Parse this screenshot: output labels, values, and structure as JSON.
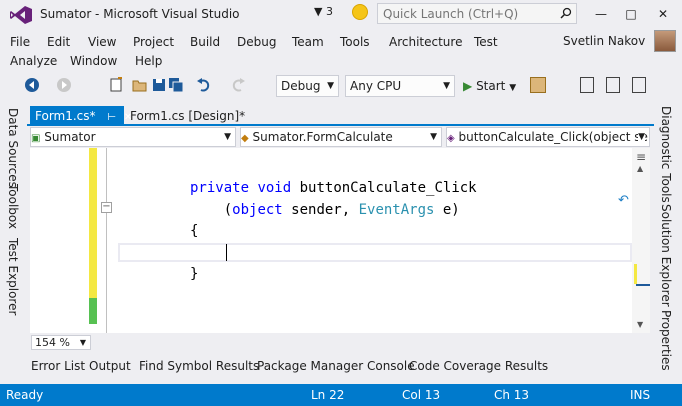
{
  "window": {
    "title": "Sumator - Microsoft Visual Studio",
    "notification_count": "3",
    "quick_launch_placeholder": "Quick Launch (Ctrl+Q)"
  },
  "menu": {
    "row1": [
      "File",
      "Edit",
      "View",
      "Project",
      "Build",
      "Debug",
      "Team",
      "Tools",
      "Architecture",
      "Test"
    ],
    "row2": [
      "Analyze",
      "Window",
      "Help"
    ],
    "user_name": "Svetlin Nakov"
  },
  "toolbar": {
    "configuration": "Debug",
    "platform": "Any CPU",
    "start_label": "Start"
  },
  "left_tabs": [
    "Data Sources",
    "Toolbox",
    "Test Explorer"
  ],
  "right_tabs": [
    "Diagnostic Tools",
    "Solution Explorer",
    "Properties"
  ],
  "doc_tabs": {
    "active": "Form1.cs*",
    "inactive": "Form1.cs [Design]*"
  },
  "navbar": {
    "project": "Sumator",
    "class": "Sumator.FormCalculate",
    "member": "buttonCalculate_Click(object se"
  },
  "code": {
    "line1_kw1": "private",
    "line1_kw2": "void",
    "line1_name": " buttonCalculate_Click",
    "line2_open": "(",
    "line2_kw": "object",
    "line2_mid": " sender, ",
    "line2_type": "EventArgs",
    "line2_end": " e)",
    "line3": "{",
    "line5": "}"
  },
  "zoom": "154 %",
  "bottom_tabs": [
    "Error List",
    "Output",
    "Find Symbol Results",
    "Package Manager Console",
    "Code Coverage Results"
  ],
  "status": {
    "state": "Ready",
    "line": "Ln 22",
    "col": "Col 13",
    "ch": "Ch 13",
    "mode": "INS"
  },
  "colors": {
    "accent": "#007acc",
    "keyword": "#0000ff",
    "type": "#2b91af",
    "changed_marker": "#f4e842",
    "saved_marker": "#57c152"
  },
  "icons": [
    "vs-logo-icon",
    "filter-icon",
    "feedback-smiley-icon",
    "search-icon",
    "minimize-icon",
    "maximize-icon",
    "close-icon",
    "back-icon",
    "forward-icon",
    "new-project-icon",
    "open-icon",
    "save-icon",
    "save-all-icon",
    "undo-icon",
    "redo-icon",
    "play-icon"
  ]
}
